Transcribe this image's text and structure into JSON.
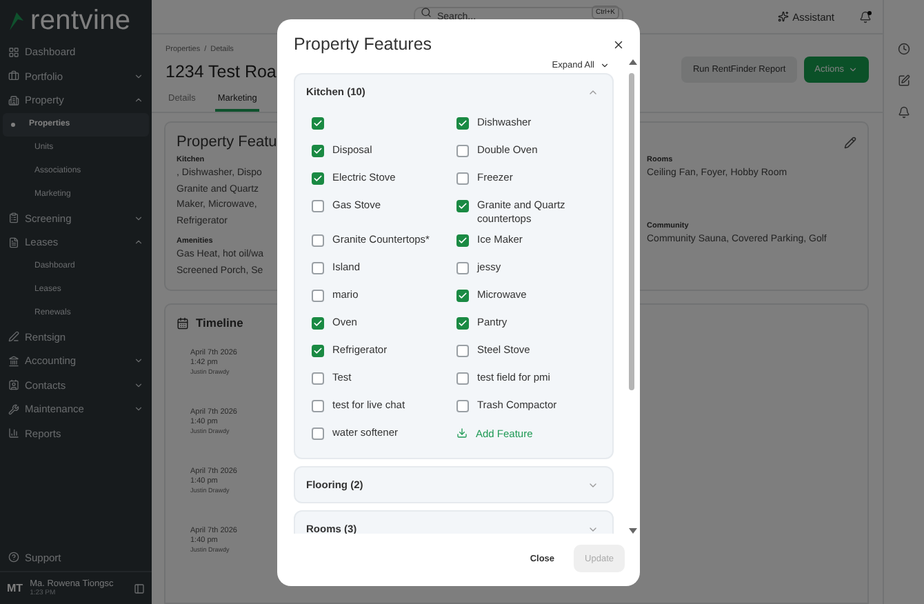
{
  "sidebar": {
    "logo": "rentvine",
    "items": [
      {
        "kind": "link",
        "label": "Dashboard"
      },
      {
        "kind": "group",
        "label": "Portfolio",
        "expanded": false
      },
      {
        "kind": "group",
        "label": "Property",
        "expanded": true,
        "children": [
          {
            "label": "Properties",
            "selected": true
          },
          {
            "label": "Units",
            "selected": false
          },
          {
            "label": "Associations",
            "selected": false
          },
          {
            "label": "Marketing",
            "selected": false
          }
        ]
      },
      {
        "kind": "group",
        "label": "Screening",
        "expanded": false
      },
      {
        "kind": "group",
        "label": "Leases",
        "expanded": true,
        "children": [
          {
            "label": "Dashboard",
            "selected": false
          },
          {
            "label": "Leases",
            "selected": false
          },
          {
            "label": "Renewals",
            "selected": false
          }
        ]
      },
      {
        "kind": "link",
        "label": "Rentsign"
      },
      {
        "kind": "group",
        "label": "Accounting",
        "expanded": false
      },
      {
        "kind": "group",
        "label": "Contacts",
        "expanded": false
      },
      {
        "kind": "group",
        "label": "Maintenance",
        "expanded": false
      },
      {
        "kind": "link",
        "label": "Reports"
      }
    ],
    "support": "Support",
    "user": {
      "initials": "MT",
      "name": "Ma. Rowena Tiongsc",
      "time": "1:23 PM"
    }
  },
  "topbar": {
    "search_placeholder": "Search...",
    "shortcut": "Ctrl+K",
    "assistant": "Assistant",
    "notifications_unread": true
  },
  "page": {
    "breadcrumbs": [
      "Properties",
      "Details"
    ],
    "separator": "/",
    "title": "1234 Test Roa",
    "buttons": [
      {
        "kind": "secondary",
        "label": "Run RentFinder Report"
      },
      {
        "kind": "primary",
        "label": "Actions"
      }
    ],
    "tabs": [
      {
        "label": "Details",
        "selected": false
      },
      {
        "label": "Marketing",
        "selected": true
      }
    ]
  },
  "features_card": {
    "title": "Property Featu",
    "left": [
      {
        "heading": "Kitchen",
        "lines": [
          ", Dishwasher, Dispo",
          "Granite and Quartz",
          "Maker, Microwave,",
          "Refrigerator"
        ]
      },
      {
        "heading": "Amenities",
        "lines": [
          "Gas Heat, hot oil/wa",
          "Screened Porch, Se"
        ]
      }
    ],
    "right": [
      {
        "heading": "Rooms",
        "lines": [
          "Ceiling Fan, Foyer, Hobby Room"
        ]
      },
      {
        "heading": "Community",
        "lines": [
          "Community Sauna, Covered Parking, Golf"
        ]
      }
    ]
  },
  "timeline": {
    "title": "Timeline",
    "entries": [
      {
        "date": "April 7th 2026",
        "time": "1:42 pm",
        "user": "Justin Drawdy"
      },
      {
        "date": "April 7th 2026",
        "time": "1:40 pm",
        "user": "Justin Drawdy"
      },
      {
        "date": "April 7th 2026",
        "time": "1:40 pm",
        "user": "Justin Drawdy"
      },
      {
        "date": "April 7th 2026",
        "time": "1:40 pm",
        "user": "Justin Drawdy"
      }
    ]
  },
  "modal": {
    "title": "Property Features",
    "expand_all": "Expand All",
    "sections": [
      {
        "title": "Kitchen (10)",
        "expanded": true,
        "add_label": "Add Feature",
        "items": [
          {
            "checked": true
          },
          {
            "label": "Dishwasher",
            "checked": true
          },
          {
            "label": "Disposal",
            "checked": true
          },
          {
            "label": "Double Oven",
            "checked": false
          },
          {
            "label": "Electric Stove",
            "checked": true
          },
          {
            "label": "Freezer",
            "checked": false
          },
          {
            "label": "Gas Stove",
            "checked": false
          },
          {
            "label": "Granite and Quartz countertops",
            "checked": true
          },
          {
            "label": "Granite Countertops*",
            "checked": false
          },
          {
            "label": "Ice Maker",
            "checked": true
          },
          {
            "label": "Island",
            "checked": false
          },
          {
            "label": "jessy",
            "checked": false
          },
          {
            "label": "mario",
            "checked": false
          },
          {
            "label": "Microwave",
            "checked": true
          },
          {
            "label": "Oven",
            "checked": true
          },
          {
            "label": "Pantry",
            "checked": true
          },
          {
            "label": "Refrigerator",
            "checked": true
          },
          {
            "label": "Steel Stove",
            "checked": false
          },
          {
            "label": "Test",
            "checked": false
          },
          {
            "label": "test field for pmi",
            "checked": false
          },
          {
            "label": "test for live chat",
            "checked": false
          },
          {
            "label": "Trash Compactor",
            "checked": false
          },
          {
            "label": "water softener",
            "checked": false
          }
        ]
      },
      {
        "title": "Flooring (2)",
        "expanded": false
      },
      {
        "title": "Rooms (3)",
        "expanded": false
      }
    ],
    "buttons": [
      {
        "kind": "text",
        "label": "Close",
        "disabled": false
      },
      {
        "kind": "primary",
        "label": "Update",
        "disabled": true
      }
    ]
  }
}
